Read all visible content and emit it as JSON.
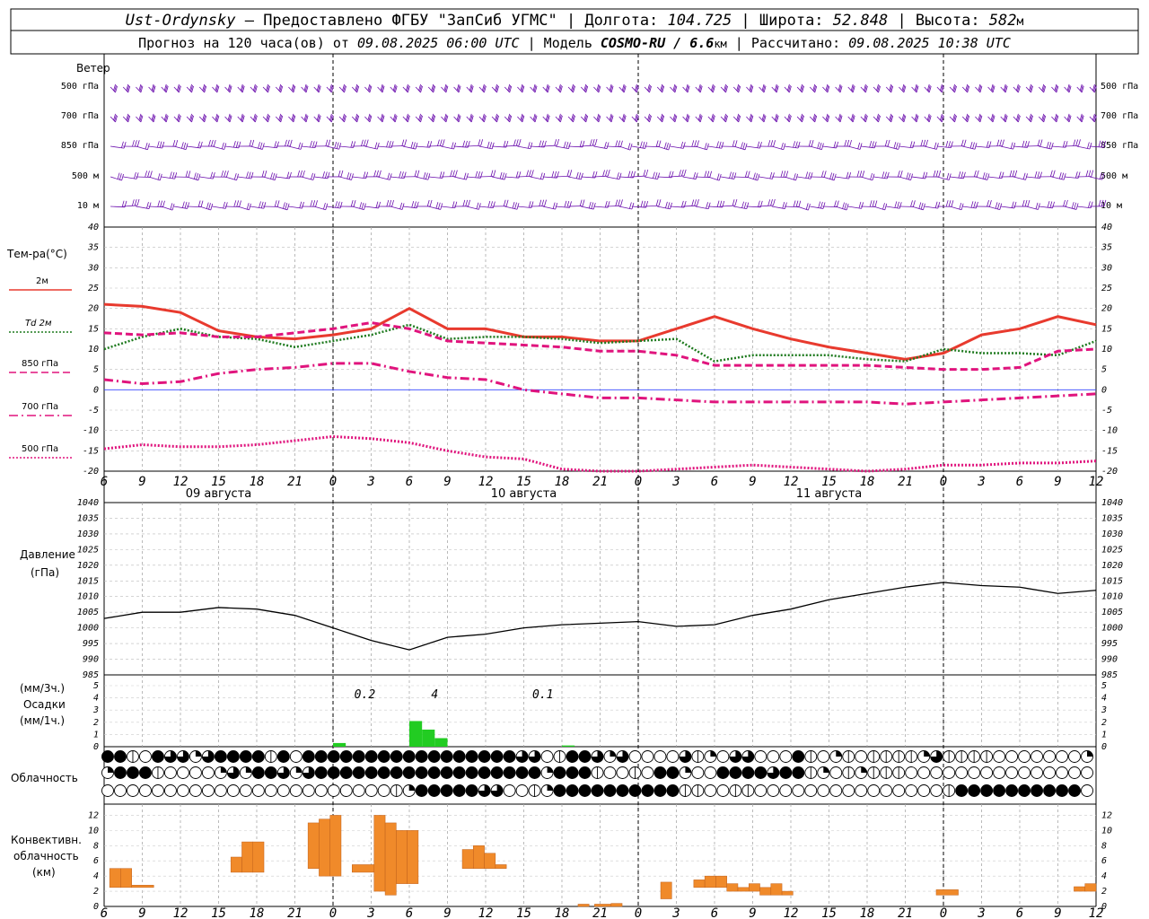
{
  "header": {
    "station": "Ust-Ordynsky",
    "provider": " — Предоставлено ФГБУ \"ЗапСиб УГМС\" | Долгота: ",
    "lon": "104.725",
    "lat_label": " | Широта: ",
    "lat": "52.848",
    "alt_label": " | Высота: ",
    "alt": "582",
    "alt_unit": "м",
    "forecast_prefix": "Прогноз на 120 часа(ов) от ",
    "forecast_time": "09.08.2025 06:00 UTC",
    "model_label": " | Модель ",
    "model": "COSMO-RU / 6.6",
    "model_unit": "км",
    "calc_label": " | Рассчитано: ",
    "calc_time": "09.08.2025 10:38 UTC"
  },
  "wind_panel": {
    "title": "Ветер",
    "levels": [
      "500 гПа",
      "700 гПа",
      "850 гПа",
      "500 м",
      "10 м"
    ],
    "color": "#6a0dad"
  },
  "temp_panel": {
    "title": "Тем-ра(°С)",
    "legend": [
      {
        "label": "2м",
        "color": "#e83a2e",
        "style": "solid"
      },
      {
        "label": "Td 2м",
        "color": "#1e7a1e",
        "style": "dotted"
      },
      {
        "label": "850 гПа",
        "color": "#e0147d",
        "style": "dashed"
      },
      {
        "label": "700 гПа",
        "color": "#e0147d",
        "style": "dashdot"
      },
      {
        "label": "500 гПа",
        "color": "#e0147d",
        "style": "dotted"
      }
    ],
    "y_ticks": [
      "40",
      "35",
      "30",
      "25",
      "20",
      "15",
      "10",
      "5",
      "0",
      "-5",
      "-10",
      "-15",
      "-20"
    ]
  },
  "x_axis": {
    "ticks": [
      "6",
      "9",
      "12",
      "15",
      "18",
      "21",
      "0",
      "3",
      "6",
      "9",
      "12",
      "15",
      "18",
      "21",
      "0",
      "3",
      "6",
      "9",
      "12",
      "15",
      "18",
      "21",
      "0",
      "3",
      "6",
      "9",
      "12"
    ],
    "days": [
      "09 августа",
      "10 августа",
      "11 августа"
    ]
  },
  "pressure_panel": {
    "title_1": "Давление",
    "title_2": "(гПа)",
    "y_ticks": [
      "1040",
      "1035",
      "1030",
      "1025",
      "1020",
      "1015",
      "1010",
      "1005",
      "1000",
      "995",
      "990",
      "985"
    ]
  },
  "precip_panel": {
    "title_1": "(мм/3ч.)",
    "title_2": "Осадки",
    "title_3": "(мм/1ч.)",
    "y_ticks": [
      "5",
      "4",
      "3",
      "2",
      "1",
      "0"
    ],
    "totals": [
      "0.2",
      "4",
      "0.1"
    ],
    "color": "#22cc22"
  },
  "cloud_panel": {
    "title": "Облачность"
  },
  "conv_panel": {
    "title_1": "Конвективн.",
    "title_2": "облачность",
    "title_3": "(км)",
    "y_ticks": [
      "12",
      "10",
      "8",
      "6",
      "4",
      "2",
      "0"
    ],
    "color": "#f08a2a"
  },
  "chart_data": [
    {
      "type": "line",
      "title": "Тем-ра(°С)",
      "x_hours_from_start": [
        0,
        3,
        6,
        9,
        12,
        15,
        18,
        21,
        24,
        27,
        30,
        33,
        36,
        39,
        42,
        45,
        48,
        51,
        54,
        57,
        60,
        63,
        66,
        69,
        72,
        75,
        78
      ],
      "ylim": [
        -20,
        40
      ],
      "series": [
        {
          "name": "2м",
          "values": [
            21,
            20.5,
            19,
            14.5,
            13,
            12.5,
            13.5,
            15,
            20,
            15,
            15,
            13,
            13,
            12,
            12,
            15,
            18,
            15,
            12.5,
            10.5,
            9,
            7.5,
            9,
            13.5,
            15,
            18,
            16
          ]
        },
        {
          "name": "Td 2м",
          "values": [
            10,
            13,
            15,
            13,
            12.5,
            10.5,
            12,
            13.5,
            16,
            12.5,
            13,
            13,
            12.5,
            11.5,
            12,
            12.5,
            7,
            8.5,
            8.5,
            8.5,
            7.5,
            7,
            10,
            9,
            9,
            8.5,
            12
          ]
        },
        {
          "name": "850 гПа",
          "values": [
            14,
            13.5,
            14,
            13,
            13,
            14,
            15,
            16.5,
            15,
            12,
            11.5,
            11,
            10.5,
            9.5,
            9.5,
            8.5,
            6,
            6,
            6,
            6,
            6,
            5.5,
            5,
            5,
            5.5,
            9.5,
            10
          ]
        },
        {
          "name": "700 гПа",
          "values": [
            2.5,
            1.5,
            2,
            4,
            5,
            5.5,
            6.5,
            6.5,
            4.5,
            3,
            2.5,
            0,
            -1,
            -2,
            -2,
            -2.5,
            -3,
            -3,
            -3,
            -3,
            -3,
            -3.5,
            -3,
            -2.5,
            -2,
            -1.5,
            -1
          ]
        },
        {
          "name": "500 гПа",
          "values": [
            -14.5,
            -13.5,
            -14,
            -14,
            -13.5,
            -12.5,
            -11.5,
            -12,
            -13,
            -15,
            -16.5,
            -17,
            -19.5,
            -20,
            -20,
            -19.5,
            -19,
            -18.5,
            -19,
            -19.5,
            -20,
            -19.5,
            -18.5,
            -18.5,
            -18,
            -18,
            -17.5
          ]
        }
      ]
    },
    {
      "type": "line",
      "title": "Давление",
      "ylim": [
        985,
        1040
      ],
      "x_hours_from_start": [
        0,
        3,
        6,
        9,
        12,
        15,
        18,
        21,
        24,
        27,
        30,
        33,
        36,
        39,
        42,
        45,
        48,
        51,
        54,
        57,
        60,
        63,
        66,
        69,
        72,
        75,
        78
      ],
      "series": [
        {
          "name": "",
          "values": [
            1003,
            1005,
            1005,
            1006.5,
            1006,
            1004,
            1000,
            996,
            993,
            997,
            998,
            1000,
            1001,
            1001.5,
            1002,
            1000.5,
            1001,
            1004,
            1006,
            1009,
            1011,
            1013,
            1014.5,
            1013.5,
            1013,
            1011,
            1012
          ]
        }
      ]
    },
    {
      "type": "bar",
      "title": "Осадки",
      "ylim": [
        0,
        5
      ],
      "x_hours_from_start": [
        18,
        24,
        25,
        26,
        36
      ],
      "values": [
        0.3,
        2.1,
        1.4,
        0.7,
        0.1
      ]
    },
    {
      "type": "bar",
      "title": "Конвективн. облачность",
      "ylim": [
        0,
        13
      ],
      "intervals": [
        {
          "h0": 0.5,
          "h1": 1.5,
          "base": 2.5,
          "top": 5
        },
        {
          "h0": 1.5,
          "h1": 2.5,
          "base": 2.5,
          "top": 5
        },
        {
          "h0": 2.5,
          "h1": 4.5,
          "base": 2.5,
          "top": 2.8
        },
        {
          "h0": 11.5,
          "h1": 12.5,
          "base": 4.5,
          "top": 6.5
        },
        {
          "h0": 12.5,
          "h1": 13.5,
          "base": 4.5,
          "top": 8.5
        },
        {
          "h0": 13.5,
          "h1": 14.5,
          "base": 4.5,
          "top": 8.5
        },
        {
          "h0": 18.5,
          "h1": 19.5,
          "base": 5,
          "top": 11
        },
        {
          "h0": 19.5,
          "h1": 20.5,
          "base": 4,
          "top": 11.5
        },
        {
          "h0": 20.5,
          "h1": 21.5,
          "base": 4,
          "top": 12
        },
        {
          "h0": 22.5,
          "h1": 24.5,
          "base": 4.5,
          "top": 5.5
        },
        {
          "h0": 24.5,
          "h1": 25.5,
          "base": 2,
          "top": 12
        },
        {
          "h0": 25.5,
          "h1": 26.5,
          "base": 1.5,
          "top": 11
        },
        {
          "h0": 26.5,
          "h1": 27.5,
          "base": 3,
          "top": 10
        },
        {
          "h0": 27.5,
          "h1": 28.5,
          "base": 3,
          "top": 10
        },
        {
          "h0": 32.5,
          "h1": 33.5,
          "base": 5,
          "top": 7.5
        },
        {
          "h0": 33.5,
          "h1": 34.5,
          "base": 5,
          "top": 8
        },
        {
          "h0": 34.5,
          "h1": 35.5,
          "base": 5,
          "top": 7
        },
        {
          "h0": 35.5,
          "h1": 36.5,
          "base": 5,
          "top": 5.5
        },
        {
          "h0": 43,
          "h1": 44,
          "base": 0,
          "top": 0.3
        },
        {
          "h0": 44.5,
          "h1": 46,
          "base": 0,
          "top": 0.3
        },
        {
          "h0": 46,
          "h1": 47,
          "base": 0,
          "top": 0.4
        },
        {
          "h0": 50.5,
          "h1": 51.5,
          "base": 1,
          "top": 3.2
        },
        {
          "h0": 53.5,
          "h1": 54.5,
          "base": 2.5,
          "top": 3.5
        },
        {
          "h0": 54.5,
          "h1": 55.5,
          "base": 2.5,
          "top": 4
        },
        {
          "h0": 55.5,
          "h1": 56.5,
          "base": 2.5,
          "top": 4
        },
        {
          "h0": 56.5,
          "h1": 57.5,
          "base": 2,
          "top": 3
        },
        {
          "h0": 57.5,
          "h1": 58.5,
          "base": 2,
          "top": 2.5
        },
        {
          "h0": 58.5,
          "h1": 59.5,
          "base": 2,
          "top": 3
        },
        {
          "h0": 59.5,
          "h1": 60.5,
          "base": 1.5,
          "top": 2.5
        },
        {
          "h0": 60.5,
          "h1": 61.5,
          "base": 1.5,
          "top": 3
        },
        {
          "h0": 61.5,
          "h1": 62.5,
          "base": 1.5,
          "top": 2
        },
        {
          "h0": 75.5,
          "h1": 77.5,
          "base": 1.5,
          "top": 2.2
        },
        {
          "h0": 88,
          "h1": 89,
          "base": 2,
          "top": 2.6
        },
        {
          "h0": 89,
          "h1": 90,
          "base": 2,
          "top": 3
        }
      ]
    }
  ]
}
